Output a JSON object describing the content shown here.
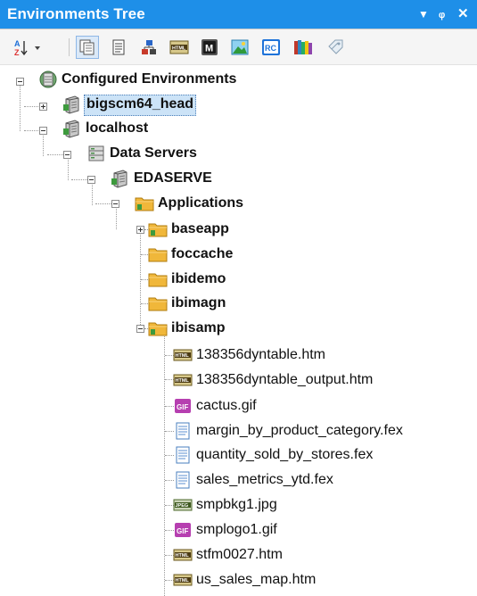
{
  "panel": {
    "title": "Environments Tree",
    "ctrl_dropdown": "▼",
    "ctrl_pin": "ᵩ",
    "ctrl_close": "✕"
  },
  "toolbar": {
    "buttons": [
      {
        "icon": "sort-icon",
        "selected": false
      },
      {
        "icon": "view-all-icon",
        "selected": true
      },
      {
        "icon": "document-icon",
        "selected": false
      },
      {
        "icon": "hierarchy-icon",
        "selected": false
      },
      {
        "icon": "html-icon",
        "selected": false
      },
      {
        "icon": "master-icon",
        "selected": false
      },
      {
        "icon": "image-icon",
        "selected": false
      },
      {
        "icon": "rc-icon",
        "selected": false
      },
      {
        "icon": "library-icon",
        "selected": false
      },
      {
        "icon": "tag-icon",
        "selected": false
      }
    ]
  },
  "tree": {
    "nodes": [
      {
        "label": "Configured Environments",
        "icon": "environments-icon",
        "bold": true,
        "expander": "minus"
      },
      {
        "label": "bigscm64_head",
        "icon": "server-icon",
        "bold": true,
        "expander": "plus",
        "highlighted": true
      },
      {
        "label": "localhost",
        "icon": "server-icon",
        "bold": true,
        "expander": "minus"
      },
      {
        "label": "Data Servers",
        "icon": "data-servers-icon",
        "bold": true,
        "expander": "minus"
      },
      {
        "label": "EDASERVE",
        "icon": "server-icon",
        "bold": true,
        "expander": "minus"
      },
      {
        "label": "Applications",
        "icon": "folder-icon",
        "bold": true,
        "expander": "minus"
      },
      {
        "label": "baseapp",
        "icon": "folder-icon",
        "bold": true,
        "expander": "plus"
      },
      {
        "label": "foccache",
        "icon": "folder-icon",
        "bold": true
      },
      {
        "label": "ibidemo",
        "icon": "folder-icon",
        "bold": true
      },
      {
        "label": "ibimagn",
        "icon": "folder-icon",
        "bold": true
      },
      {
        "label": "ibisamp",
        "icon": "folder-icon",
        "bold": true,
        "expander": "minus"
      },
      {
        "label": "138356dyntable.htm",
        "icon": "html-file-icon"
      },
      {
        "label": "138356dyntable_output.htm",
        "icon": "html-file-icon"
      },
      {
        "label": "cactus.gif",
        "icon": "gif-file-icon"
      },
      {
        "label": "margin_by_product_category.fex",
        "icon": "fex-file-icon"
      },
      {
        "label": "quantity_sold_by_stores.fex",
        "icon": "fex-file-icon"
      },
      {
        "label": "sales_metrics_ytd.fex",
        "icon": "fex-file-icon"
      },
      {
        "label": "smpbkg1.jpg",
        "icon": "jpeg-file-icon"
      },
      {
        "label": "smplogo1.gif",
        "icon": "gif-file-icon"
      },
      {
        "label": "stfm0027.htm",
        "icon": "html-file-icon"
      },
      {
        "label": "us_sales_map.htm",
        "icon": "html-file-icon"
      }
    ]
  },
  "colors": {
    "titlebar": "#1e8fe8",
    "selection": "#cce3f7",
    "folder": "#f0b73a",
    "gif": "#b63fb0"
  }
}
